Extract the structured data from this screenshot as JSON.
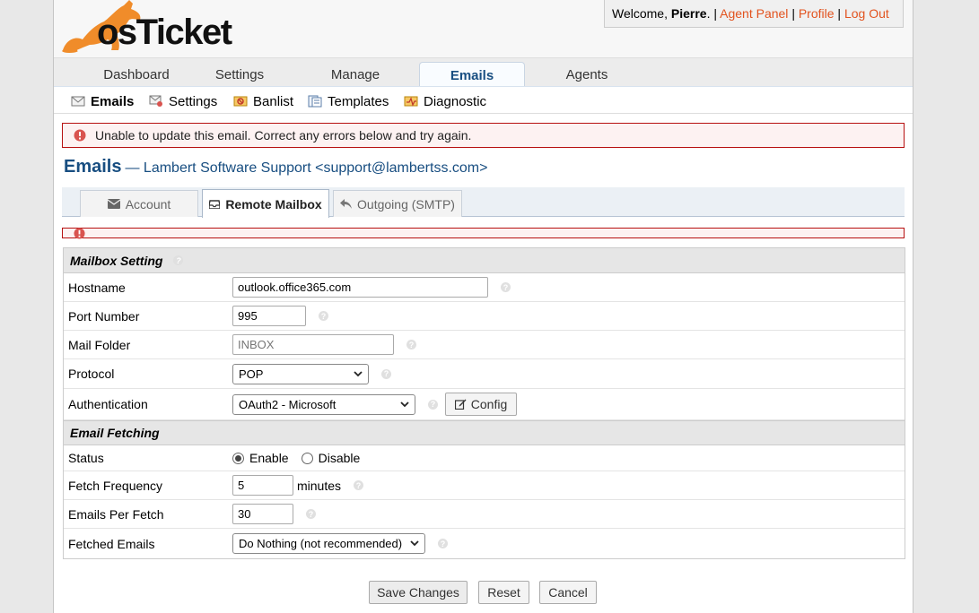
{
  "header": {
    "logo_text": "osTicket",
    "welcome_prefix": "Welcome,",
    "user_name": "Pierre",
    "welcome_suffix": ".",
    "separator": "|",
    "links": [
      "Agent Panel",
      "Profile",
      "Log Out"
    ]
  },
  "nav": {
    "tabs": [
      "Dashboard",
      "Settings",
      "Manage",
      "Emails",
      "Agents"
    ],
    "active": "Emails"
  },
  "subnav": {
    "items": [
      {
        "label": "Emails",
        "icon": "mail-icon"
      },
      {
        "label": "Settings",
        "icon": "mail-settings-icon"
      },
      {
        "label": "Banlist",
        "icon": "banlist-icon"
      },
      {
        "label": "Templates",
        "icon": "templates-icon"
      },
      {
        "label": "Diagnostic",
        "icon": "diagnostic-icon"
      }
    ],
    "active": "Emails"
  },
  "error": {
    "message": "Unable to update this email. Correct any errors below and try again."
  },
  "page": {
    "title": "Emails",
    "subtitle": "— Lambert Software Support <support@lambertss.com>"
  },
  "tabs": {
    "items": [
      "Account",
      "Remote Mailbox",
      "Outgoing (SMTP)"
    ],
    "active": "Remote Mailbox"
  },
  "mailbox_section": {
    "title": "Mailbox Setting",
    "hostname_label": "Hostname",
    "hostname_value": "outlook.office365.com",
    "port_label": "Port Number",
    "port_value": "995",
    "folder_label": "Mail Folder",
    "folder_placeholder": "INBOX",
    "protocol_label": "Protocol",
    "protocol_value": "POP",
    "auth_label": "Authentication",
    "auth_value": "OAuth2 - Microsoft",
    "config_button": "Config"
  },
  "fetch_section": {
    "title": "Email Fetching",
    "status_label": "Status",
    "status_options": [
      "Enable",
      "Disable"
    ],
    "status_selected": "Enable",
    "frequency_label": "Fetch Frequency",
    "frequency_value": "5",
    "frequency_unit": "minutes",
    "per_fetch_label": "Emails Per Fetch",
    "per_fetch_value": "30",
    "fetched_label": "Fetched Emails",
    "fetched_value": "Do Nothing (not recommended)"
  },
  "actions": {
    "save": "Save Changes",
    "reset": "Reset",
    "cancel": "Cancel"
  },
  "colors": {
    "accent": "#184e81",
    "link": "#e2531f",
    "error_border": "#b71010",
    "error_bg": "#fdf2f2"
  }
}
